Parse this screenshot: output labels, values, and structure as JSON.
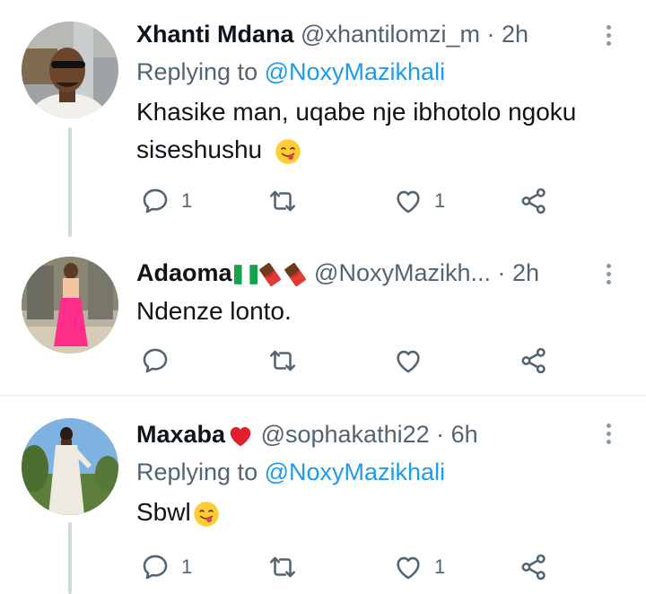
{
  "tweets": [
    {
      "name": "Xhanti Mdana",
      "handle": "@xhantilomzi_m",
      "sep": "·",
      "time": "2h",
      "replying_prefix": "Replying to",
      "replying_to": "@NoxyMazikhali",
      "text_line1": "Khasike man, uqabe nje ibhotolo ngoku",
      "text_line2": "siseshushu",
      "emoji": "yum-face",
      "reply_count": "1",
      "like_count": "1"
    },
    {
      "name": "Adaoma",
      "name_emojis": [
        "nigeria-flag",
        "chocolate-bar",
        "chocolate-bar"
      ],
      "handle": "@NoxyMazikh...",
      "sep": "·",
      "time": "2h",
      "text": "Ndenze lonto.",
      "reply_count": "",
      "like_count": ""
    },
    {
      "name": "Maxaba",
      "name_emoji": "red-heart",
      "handle": "@sophakathi22",
      "sep": "·",
      "time": "6h",
      "replying_prefix": "Replying to",
      "replying_to": "@NoxyMazikhali",
      "text": "Sbwl",
      "emoji": "yum-face",
      "reply_count": "1",
      "like_count": "1"
    }
  ],
  "colors": {
    "text": "#0f1419",
    "secondary": "#536471",
    "link": "#1d9bf0",
    "thread_line": "#cfd9de",
    "divider": "#eff3f4"
  }
}
